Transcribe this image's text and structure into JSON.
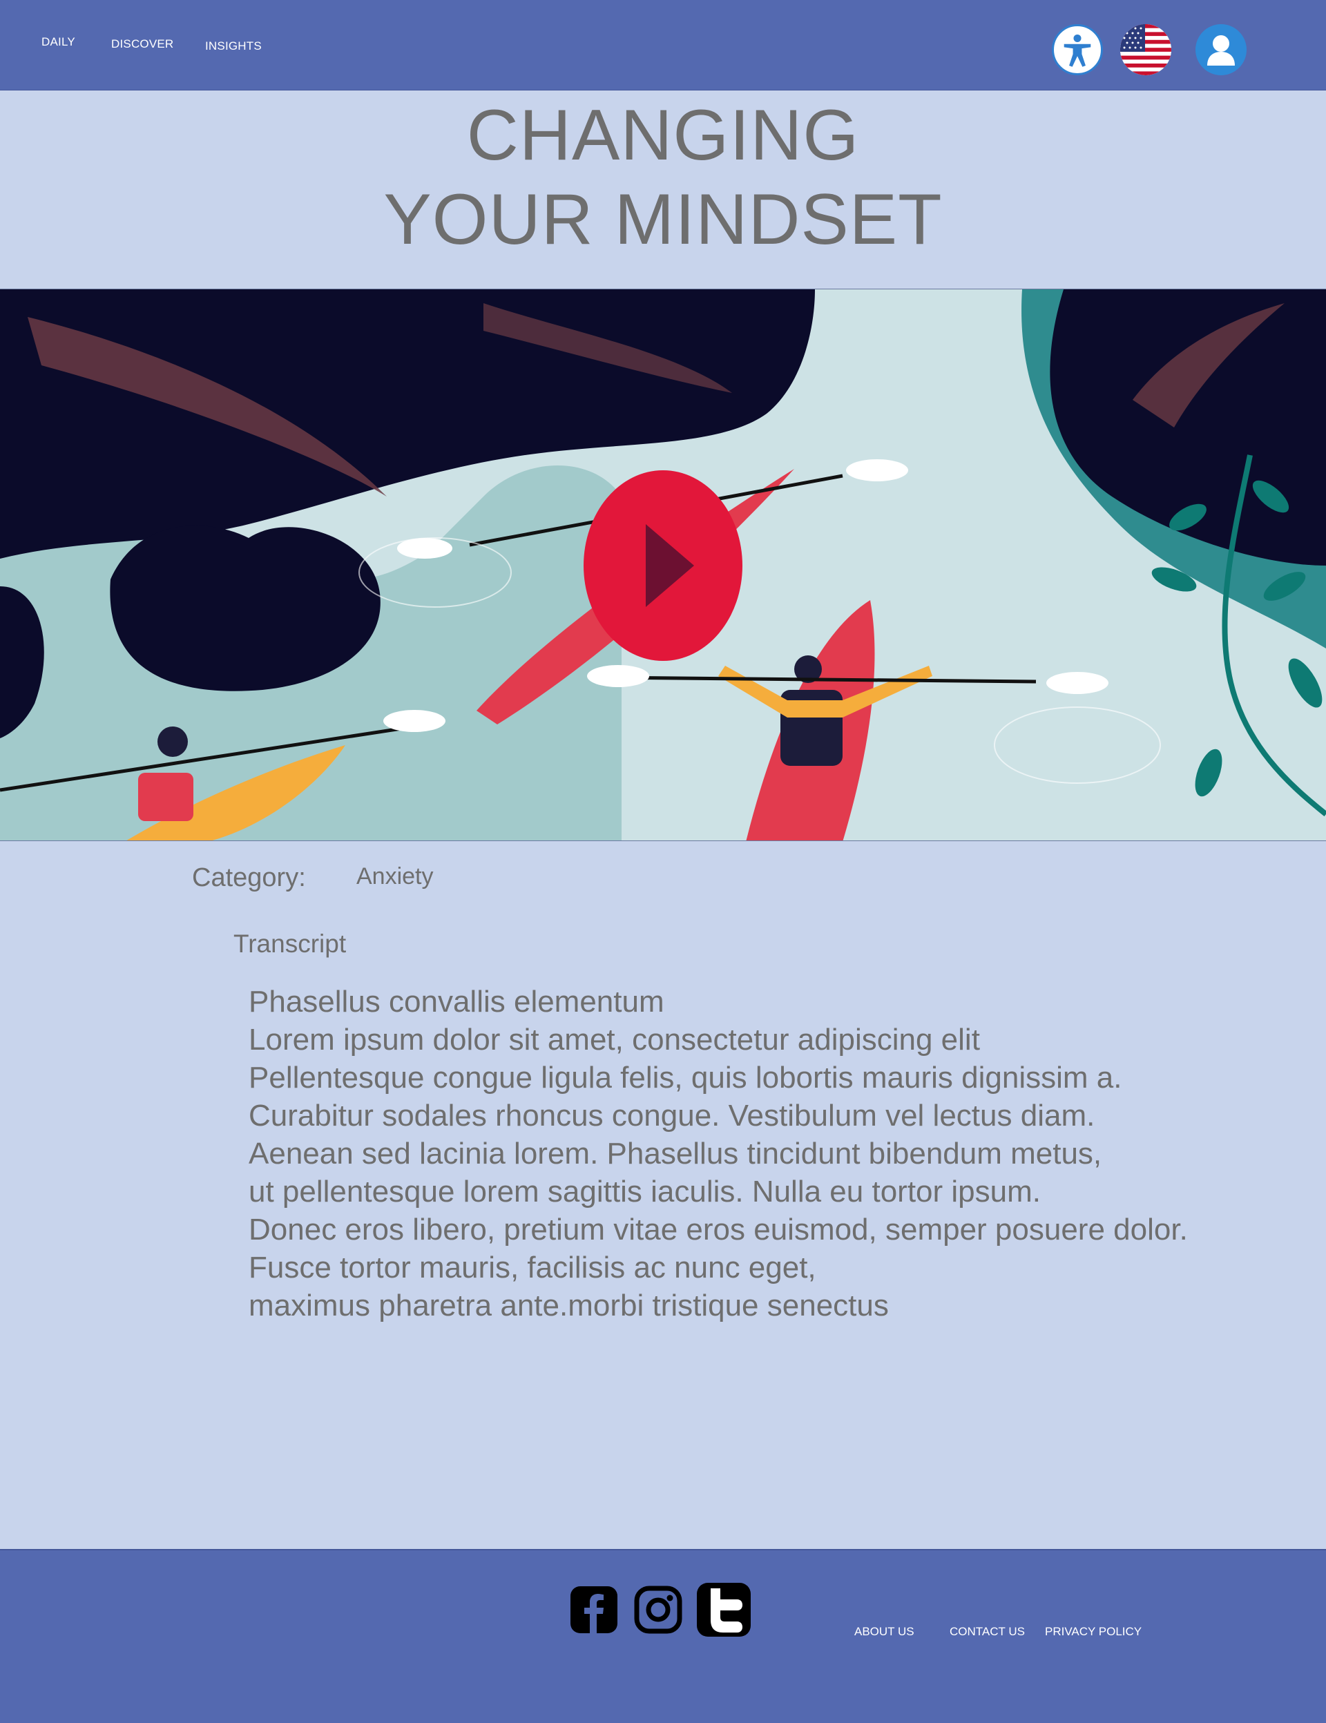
{
  "header": {
    "nav": [
      {
        "label": "DAILY"
      },
      {
        "label": "DISCOVER"
      },
      {
        "label": "INSIGHTS"
      }
    ],
    "icons": [
      "accessibility-icon",
      "us-flag-icon",
      "user-avatar-icon"
    ]
  },
  "title": {
    "line1": "CHANGING",
    "line2": "YOUR MINDSET"
  },
  "video": {
    "play_icon": "play-icon",
    "accent": "#e2173a"
  },
  "meta": {
    "category_label": "Category:",
    "category_value": "Anxiety",
    "transcript_heading": "Transcript"
  },
  "transcript": {
    "lines": [
      "Phasellus convallis elementum",
      "Lorem ipsum dolor sit amet, consectetur adipiscing elit",
      "Pellentesque congue ligula felis, quis lobortis mauris dignissim a.",
      "Curabitur sodales rhoncus congue. Vestibulum vel lectus diam.",
      "Aenean sed lacinia lorem. Phasellus tincidunt bibendum metus,",
      "ut pellentesque lorem sagittis iaculis. Nulla eu tortor ipsum.",
      "Donec eros libero, pretium vitae eros euismod, semper posuere dolor.",
      "Fusce tortor mauris, facilisis ac nunc eget,",
      "maximus pharetra ante.morbi tristique senectus"
    ]
  },
  "footer": {
    "social": [
      "facebook-icon",
      "instagram-icon",
      "twitter-icon"
    ],
    "links": [
      {
        "label": "ABOUT US"
      },
      {
        "label": "CONTACT US"
      },
      {
        "label": "PRIVACY POLICY"
      }
    ]
  },
  "colors": {
    "header_bg": "#5469b0",
    "page_bg": "#c8d4ec",
    "text": "#6e6e6e",
    "play": "#e2173a"
  }
}
